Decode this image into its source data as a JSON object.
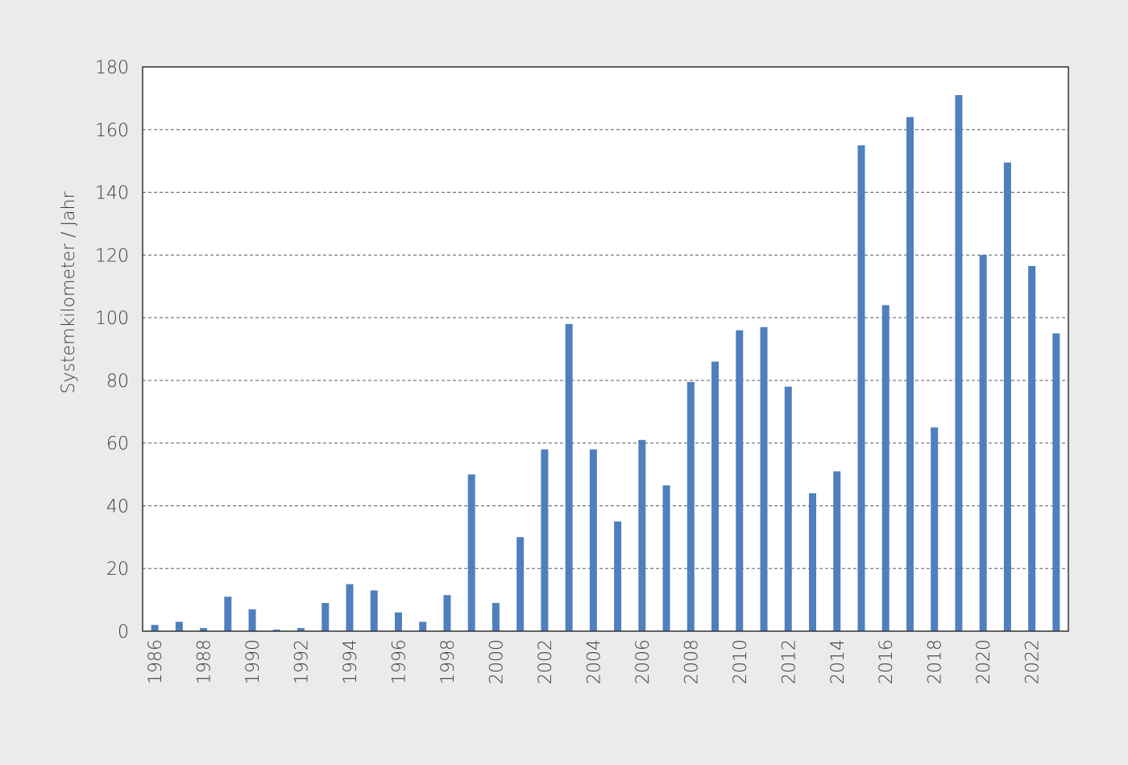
{
  "colors": {
    "background": "#ebebeb",
    "plot_background": "#ffffff",
    "bar": "#4f80bd",
    "grid": "#444444",
    "axis": "#333333",
    "text": "#3c3c3c"
  },
  "chart_data": {
    "type": "bar",
    "title": "",
    "xlabel": "",
    "ylabel": "Systemkilometer / Jahr",
    "ylim": [
      0,
      180
    ],
    "yticks": [
      "0",
      "20",
      "40",
      "60",
      "80",
      "100",
      "120",
      "140",
      "160",
      "180"
    ],
    "grid": "horizontal dashed",
    "categories": [
      "1986",
      "1987",
      "1988",
      "1989",
      "1990",
      "1991",
      "1992",
      "1993",
      "1994",
      "1995",
      "1996",
      "1997",
      "1998",
      "1999",
      "2000",
      "2001",
      "2002",
      "2003",
      "2004",
      "2005",
      "2006",
      "2007",
      "2008",
      "2009",
      "2010",
      "2011",
      "2012",
      "2013",
      "2014",
      "2015",
      "2016",
      "2017",
      "2018",
      "2019",
      "2020",
      "2021",
      "2022",
      "2023"
    ],
    "xtick_labels": [
      "1986",
      "",
      "1988",
      "",
      "1990",
      "",
      "1992",
      "",
      "1994",
      "",
      "1996",
      "",
      "1998",
      "",
      "2000",
      "",
      "2002",
      "",
      "2004",
      "",
      "2006",
      "",
      "2008",
      "",
      "2010",
      "",
      "2012",
      "",
      "2014",
      "",
      "2016",
      "",
      "2018",
      "",
      "2020",
      "",
      "2022",
      ""
    ],
    "series": [
      {
        "values": [
          2,
          3,
          1,
          11,
          7,
          0.5,
          1,
          9,
          15,
          13,
          6,
          3,
          11.5,
          50,
          9,
          30,
          58,
          98,
          58,
          35,
          61,
          46.5,
          79.5,
          86,
          96,
          97,
          78,
          44,
          51,
          155,
          104,
          164,
          65,
          171,
          120,
          149.5,
          116.5,
          95
        ]
      }
    ]
  }
}
